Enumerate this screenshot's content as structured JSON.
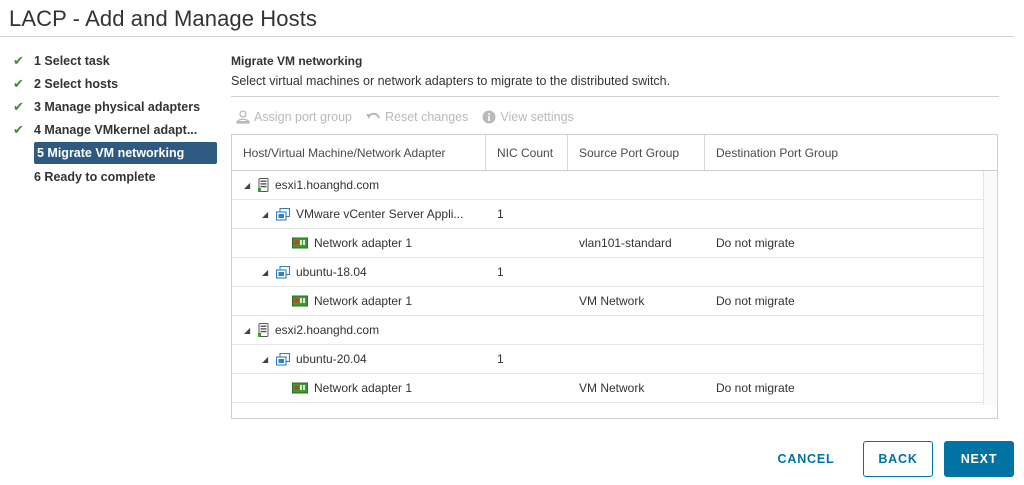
{
  "window": {
    "title": "LACP - Add and Manage Hosts"
  },
  "steps": [
    {
      "label": "1 Select task",
      "done": true
    },
    {
      "label": "2 Select hosts",
      "done": true
    },
    {
      "label": "3 Manage physical adapters",
      "done": true
    },
    {
      "label": "4 Manage VMkernel adapt...",
      "done": true
    },
    {
      "label": "5 Migrate VM networking",
      "done": false,
      "active": true
    },
    {
      "label": "6 Ready to complete",
      "done": false
    }
  ],
  "main": {
    "section_title": "Migrate VM networking",
    "description": "Select virtual machines or network adapters to migrate to the distributed switch."
  },
  "toolbar": {
    "assign": "Assign port group",
    "reset": "Reset changes",
    "view": "View settings"
  },
  "table": {
    "headers": [
      "Host/Virtual Machine/Network Adapter",
      "NIC Count",
      "Source Port Group",
      "Destination Port Group"
    ],
    "rows": [
      {
        "type": "host",
        "name": "esxi1.hoanghd.com",
        "nic": "",
        "source": "",
        "dest": ""
      },
      {
        "type": "vm",
        "name": "VMware vCenter Server Appli...",
        "nic": "1",
        "source": "",
        "dest": ""
      },
      {
        "type": "adapter",
        "name": "Network adapter 1",
        "nic": "",
        "source": "vlan101-standard",
        "dest": "Do not migrate"
      },
      {
        "type": "vm",
        "name": "ubuntu-18.04",
        "nic": "1",
        "source": "",
        "dest": ""
      },
      {
        "type": "adapter",
        "name": "Network adapter 1",
        "nic": "",
        "source": "VM Network",
        "dest": "Do not migrate"
      },
      {
        "type": "host",
        "name": "esxi2.hoanghd.com",
        "nic": "",
        "source": "",
        "dest": ""
      },
      {
        "type": "vm",
        "name": "ubuntu-20.04",
        "nic": "1",
        "source": "",
        "dest": ""
      },
      {
        "type": "adapter",
        "name": "Network adapter 1",
        "nic": "",
        "source": "VM Network",
        "dest": "Do not migrate"
      }
    ]
  },
  "buttons": {
    "cancel": "CANCEL",
    "back": "BACK",
    "next": "NEXT"
  },
  "colors": {
    "accent": "#0072a3",
    "active_step": "#2e5980",
    "check": "#3c8f2e"
  }
}
